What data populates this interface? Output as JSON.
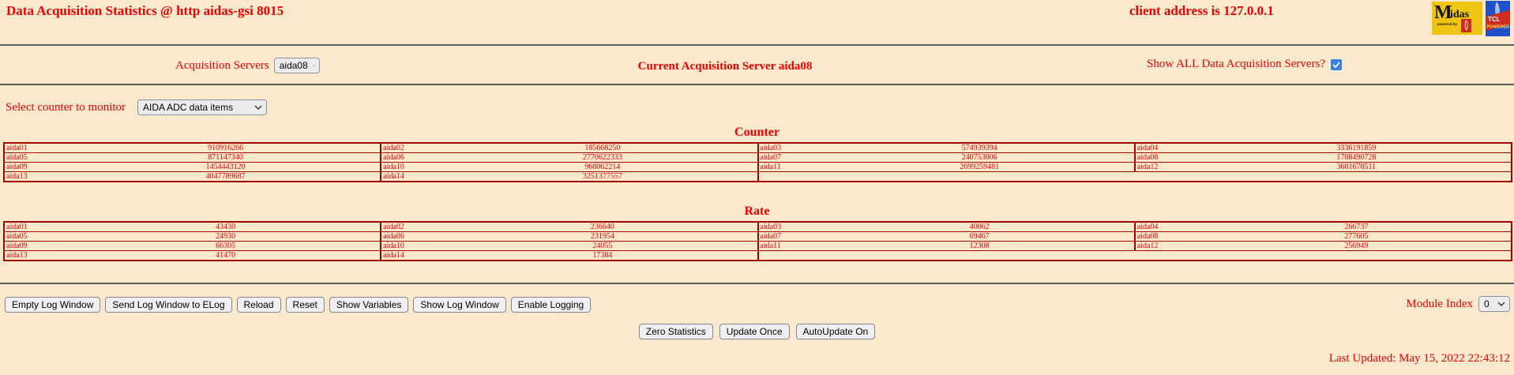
{
  "header": {
    "title": "Data Acquisition Statistics @ http aidas-gsi 8015",
    "client_address": "client address is 127.0.0.1",
    "logos": {
      "midas": {
        "text": "Midas",
        "sub": "powered by"
      },
      "tcl": {
        "text": "TCL",
        "sub": "POWERED"
      }
    }
  },
  "server_bar": {
    "label": "Acquisition Servers",
    "server_select_value": "aida08",
    "current_server_text": "Current Acquisition Server aida08",
    "show_all_label": "Show ALL Data Acquisition Servers?",
    "show_all_checked": true
  },
  "counter_bar": {
    "label": "Select counter to monitor",
    "select_value": "AIDA ADC data items"
  },
  "tables": {
    "counter": {
      "title": "Counter",
      "rows": [
        [
          [
            "aida01",
            "910916266"
          ],
          [
            "aida02",
            "185668250"
          ],
          [
            "aida03",
            "574939394"
          ],
          [
            "aida04",
            "3336191859"
          ]
        ],
        [
          [
            "aida05",
            "871147340"
          ],
          [
            "aida06",
            "2770622333"
          ],
          [
            "aida07",
            "240753006"
          ],
          [
            "aida08",
            "1788490728"
          ]
        ],
        [
          [
            "aida09",
            "1454443120"
          ],
          [
            "aida10",
            "968062214"
          ],
          [
            "aida11",
            "2699259481"
          ],
          [
            "aida12",
            "3681678511"
          ]
        ],
        [
          [
            "aida13",
            "4047789687"
          ],
          [
            "aida14",
            "3251377557"
          ]
        ]
      ]
    },
    "rate": {
      "title": "Rate",
      "rows": [
        [
          [
            "aida01",
            "43430"
          ],
          [
            "aida02",
            "236640"
          ],
          [
            "aida03",
            "40062"
          ],
          [
            "aida04",
            "266737"
          ]
        ],
        [
          [
            "aida05",
            "24930"
          ],
          [
            "aida06",
            "231954"
          ],
          [
            "aida07",
            "69467"
          ],
          [
            "aida08",
            "277605"
          ]
        ],
        [
          [
            "aida09",
            "66305"
          ],
          [
            "aida10",
            "24055"
          ],
          [
            "aida11",
            "12308"
          ],
          [
            "aida12",
            "256949"
          ]
        ],
        [
          [
            "aida13",
            "41470"
          ],
          [
            "aida14",
            "17384"
          ]
        ]
      ]
    }
  },
  "toolbar": {
    "buttons": [
      "Empty Log Window",
      "Send Log Window to ELog",
      "Reload",
      "Reset",
      "Show Variables",
      "Show Log Window",
      "Enable Logging"
    ]
  },
  "module_index": {
    "label": "Module Index",
    "value": "0"
  },
  "update_controls": {
    "buttons": [
      "Zero Statistics",
      "Update Once",
      "AutoUpdate On"
    ]
  },
  "footer": {
    "last_updated": "Last Updated: May 15, 2022 22:43:12"
  },
  "colors": {
    "text_red": "#ee0000",
    "table_border_red": "#a40000",
    "background": "#fbe9cd",
    "checkbox_blue": "#3584e4"
  }
}
